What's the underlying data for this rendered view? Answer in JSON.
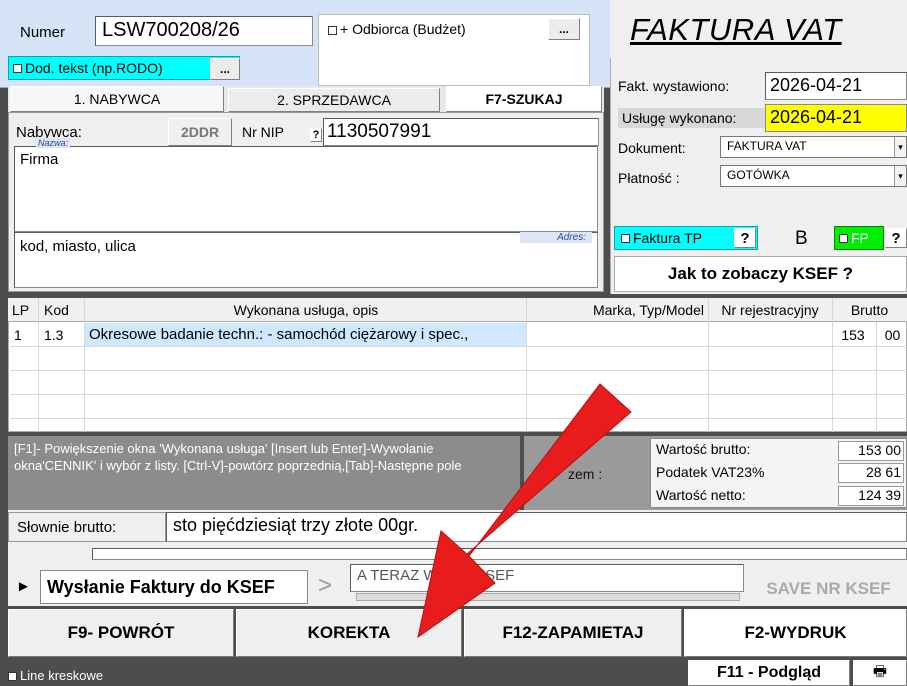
{
  "header": {
    "number_label": "Numer",
    "number_value": "LSW700208/26",
    "odbiorca_label": "+ Odbiorca (Budżet)",
    "dots": "...",
    "dod_tekst_label": "Dod. tekst (np.RODO)",
    "invoice_title": "FAKTURA VAT"
  },
  "tabs": {
    "nabywca": "1. NABYWCA",
    "sprzedawca": "2. SPRZEDAWCA",
    "szukaj": "F7-SZUKAJ"
  },
  "buyer": {
    "label": "Nabywca:",
    "code_button": "2DDR",
    "nip_label": "Nr NIP",
    "nip_help": "?",
    "nip_value": "1130507991",
    "name_caption": "Nazwa:",
    "name_value": "Firma",
    "address_caption": "Adres:",
    "address_value": "kod, miasto, ulica"
  },
  "dates": {
    "issued_label": "Fakt. wystawiono:",
    "issued_value": "2026-04-21",
    "service_label": "Usługę wykonano:",
    "service_value": "2026-04-21",
    "document_label": "Dokument:",
    "document_value": "FAKTURA VAT",
    "payment_label": "Płatność :",
    "payment_value": "GOTÓWKA",
    "dropdown_arrow": "▾"
  },
  "flags": {
    "faktura_tp": "Faktura TP",
    "help": "?",
    "b_letter": "B",
    "fp": "FP",
    "ksef_question": "Jak to zobaczy KSEF ?"
  },
  "table": {
    "columns": [
      "LP",
      "Kod",
      "Wykonana usługa, opis",
      "Marka, Typ/Model",
      "Nr rejestracyjny",
      "Brutto"
    ],
    "rows": [
      {
        "lp": "1",
        "kod": "1.3",
        "opis": "Okresowe badanie techn.: - samochód ciężarowy i spec.,",
        "marka": "",
        "nr_rej": "",
        "brutto_zl": "153",
        "brutto_gr": "00"
      }
    ]
  },
  "hint": "[F1]- Powiększenie okna 'Wykonana usługa' [Insert lub Enter]-Wywołanie okna'CENNIK' i wybór z listy. [Ctrl-V]-powtórz poprzednią,[Tab]-Następne pole",
  "totals": {
    "razem_label": "zem :",
    "brutto_label": "Wartość brutto:",
    "brutto_zl": "153",
    "brutto_gr": "00",
    "vat_label": "Podatek VAT23%",
    "vat_zl": "28",
    "vat_gr": "61",
    "netto_label": "Wartość netto:",
    "netto_zl": "124",
    "netto_gr": "39"
  },
  "words": {
    "label": "Słownie brutto:",
    "value": "sto pięćdziesiąt trzy złote  00gr."
  },
  "ksef": {
    "play": "►",
    "send_label": "Wysłanie Faktury do KSEF",
    "chevron": ">",
    "status_text": "A TERAZ W      u do KSEF",
    "save_nr": "SAVE NR KSEF"
  },
  "buttons": {
    "f9": "F9- POWRÓT",
    "korekta": "KOREKTA",
    "f12": "F12-ZAPAMIETAJ",
    "f2": "F2-WYDRUK",
    "f11": "F11 - Podgląd",
    "printer": "🖶"
  },
  "footer": {
    "barcode_label": "Line kreskowe"
  },
  "colors": {
    "header_blue": "#d6e4f7",
    "cyan": "#00ffff",
    "yellow": "#ffff00",
    "green": "#00ee00",
    "row_highlight": "#cfe8ff",
    "arrow_red": "#e81c1c"
  }
}
